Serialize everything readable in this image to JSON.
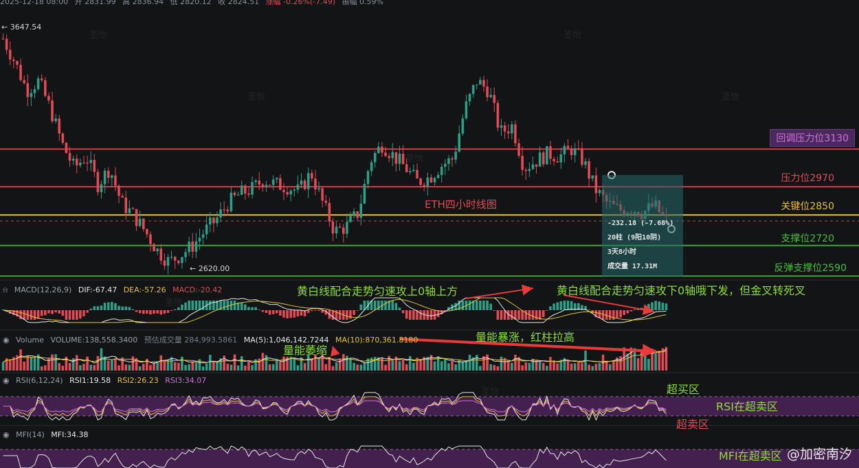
{
  "header": {
    "datetime": "2025-12-18 08:00",
    "open": "开 2831.99",
    "high": "高 2836.94",
    "low": "低 2820.12",
    "close": "收 2824.51",
    "change": "涨幅 -0.26%(-7.49)",
    "amplitude": "振幅 0.59%"
  },
  "price_marks": {
    "high": "← 3647.54",
    "low": "← 2620.00"
  },
  "levels": [
    {
      "label": "回调压力位3130",
      "value": 3130,
      "color": "#d9374b"
    },
    {
      "label": "压力位2970",
      "value": 2970,
      "color": "#d9374b"
    },
    {
      "label": "关键位2850",
      "value": 2850,
      "color": "#e6c23a"
    },
    {
      "label": "支撑位2720",
      "value": 2720,
      "color": "#3fa536"
    },
    {
      "label": "反弹支撑位2590",
      "value": 2590,
      "color": "#3fa536"
    }
  ],
  "chart_title": "ETH四小时线图",
  "info_box": {
    "change": "-232.18 (-7.68%)",
    "bars": "20柱 (9阳10阴)",
    "duration": "3天8小时",
    "volume": "成交量 17.31M"
  },
  "macd": {
    "label": "MACD(12,26,9)",
    "dif": "DIF:-67.47",
    "dea": "DEA:-57.26",
    "macd": "MACD:-20.42"
  },
  "volume": {
    "label": "Volume",
    "vol": "VOLUME:138,558.3400",
    "est": "预估成交量 284,993.5861",
    "ma5": "MA(5):1,046,142.7244",
    "ma10": "MA(10):870,361.8180"
  },
  "rsi": {
    "label": "RSI(6,12,24)",
    "rsi1": "RSI1:19.58",
    "rsi2": "RSI2:26.23",
    "rsi3": "RSI3:34.07"
  },
  "mfi": {
    "label": "MFI(14)",
    "mfi": "MFI:34.38"
  },
  "annotations": {
    "macd_left": "黄白线配合走势匀速攻上0轴上方",
    "macd_right": "黄白线配合走势匀速攻下0轴哦下发，但金叉转死叉",
    "vol_surge": "量能暴涨，红柱拉高",
    "vol_shrink": "量能萎缩",
    "overbought": "超买区",
    "rsi_oversold": "RSI在超卖区",
    "oversold": "超卖区",
    "mfi_oversold": "MFI在超卖区"
  },
  "watermark": "圣怡",
  "brand": "@加密南汐",
  "colors": {
    "up": "#2f9e86",
    "down": "#e04b55",
    "bg": "#121416",
    "accent": "#8fdc3c",
    "band": "#5a2566"
  },
  "chart_data": {
    "type": "candlestick",
    "symbol": "ETH",
    "timeframe": "4H",
    "ylim": [
      2560,
      3700
    ],
    "price_high": 3647.54,
    "price_low": 2620.0,
    "support_resistance": [
      3130,
      2970,
      2850,
      2720,
      2590
    ],
    "close_path": [
      3600,
      3500,
      3380,
      3420,
      3300,
      3150,
      3050,
      3100,
      2980,
      3050,
      2900,
      2850,
      2780,
      2700,
      2650,
      2680,
      2720,
      2780,
      2830,
      2900,
      2940,
      2960,
      3000,
      2980,
      2970,
      2950,
      3030,
      2900,
      2780,
      2800,
      2860,
      3080,
      3150,
      3100,
      3050,
      2990,
      3010,
      3060,
      3090,
      3300,
      3420,
      3380,
      3200,
      3230,
      3050,
      3080,
      3110,
      3100,
      3130,
      3080,
      2960,
      2900,
      2870,
      2880,
      2860,
      2890,
      2824
    ],
    "panels": {
      "macd": {
        "dif": -67.47,
        "dea": -57.26,
        "macd": -20.42
      },
      "volume": {
        "volume": 138558.34,
        "estimated": 284993.5861,
        "ma5": 1046142.7244,
        "ma10": 870361.818
      },
      "rsi": {
        "rsi1": 19.58,
        "rsi2": 26.23,
        "rsi3": 34.07
      },
      "mfi": {
        "mfi": 34.38
      }
    }
  }
}
